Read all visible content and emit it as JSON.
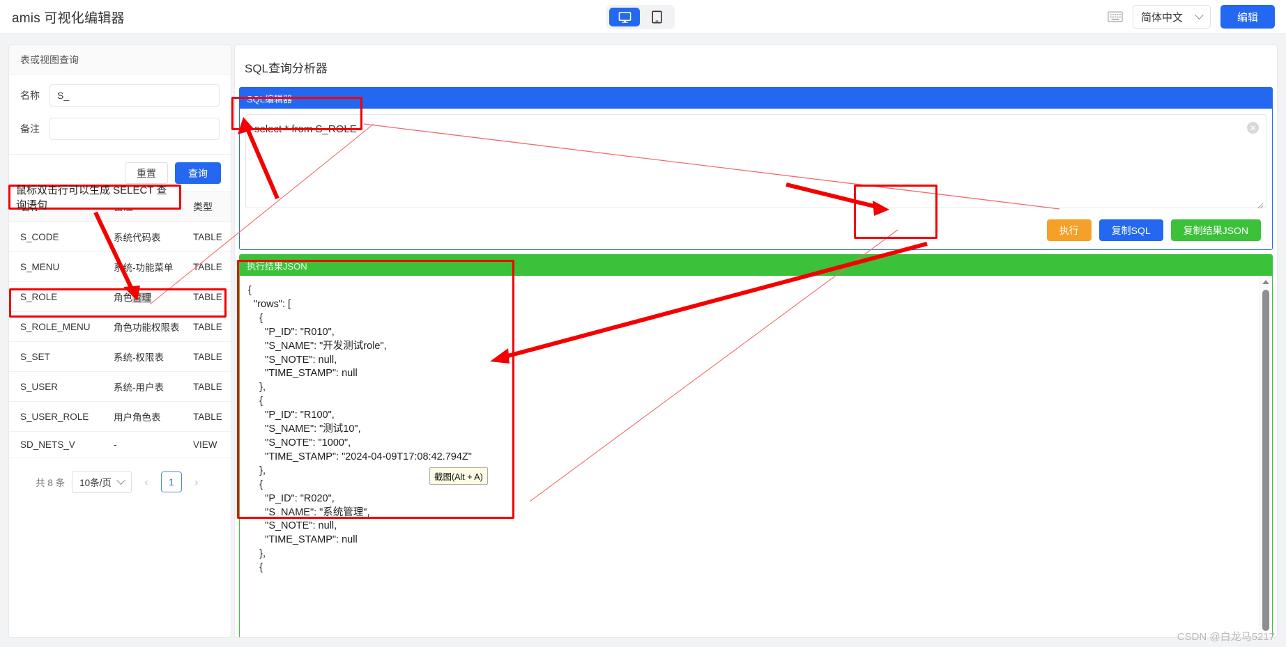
{
  "topbar": {
    "brand": "amis 可视化编辑器",
    "viewport": {
      "desktop_icon": "desktop-monitor-icon",
      "mobile_icon": "mobile-phone-icon",
      "active": "desktop"
    },
    "keyboard_icon": "keyboard-icon",
    "language": "简体中文",
    "language_chevron": "chevron-down-icon",
    "edit_button": "编辑"
  },
  "left_panel": {
    "header": "表或视图查询",
    "form": {
      "name_label": "名称",
      "name_value": "S_",
      "name_placeholder": "",
      "note_label": "备注",
      "note_value": "",
      "note_placeholder": "",
      "reset_button": "重置",
      "query_button": "查询"
    },
    "annotation_note": "鼠标双击行可以生成 SELECT 查询语句",
    "table": {
      "columns": [
        "名称",
        "备注",
        "类型"
      ],
      "rows": [
        {
          "name": "S_CODE",
          "note": "系统代码表",
          "type": "TABLE"
        },
        {
          "name": "S_MENU",
          "note": "系统-功能菜单",
          "type": "TABLE"
        },
        {
          "name": "S_ROLE",
          "note": "角色管理",
          "note_plain": "角色",
          "note_selected": "管理",
          "type": "TABLE"
        },
        {
          "name": "S_ROLE_MENU",
          "note": "角色功能权限表",
          "type": "TABLE"
        },
        {
          "name": "S_SET",
          "note": "系统-权限表",
          "type": "TABLE"
        },
        {
          "name": "S_USER",
          "note": "系统-用户表",
          "type": "TABLE"
        },
        {
          "name": "S_USER_ROLE",
          "note": "用户角色表",
          "type": "TABLE"
        },
        {
          "name": "SD_NETS_V",
          "note": "-",
          "type": "VIEW"
        }
      ]
    },
    "pagination": {
      "total_text": "共 8 条",
      "page_size": "10条/页",
      "page_size_chevron": "chevron-down-icon",
      "prev_icon": "chevron-left-icon",
      "next_icon": "chevron-right-icon",
      "current_page": "1"
    }
  },
  "right_panel": {
    "title": "SQL查询分析器",
    "sql_editor": {
      "header": "SQL编辑器",
      "value": "select * from S_ROLE",
      "placeholder": "",
      "clear_icon": "clear-circle-x-icon",
      "resize_icon": "resize-handle-icon",
      "buttons": {
        "execute": "执行",
        "copy_sql": "复制SQL",
        "copy_json": "复制结果JSON"
      }
    },
    "result": {
      "header": "执行结果JSON",
      "scroll_up_icon": "scroll-up-arrow-icon",
      "json_text": "{\n  \"rows\": [\n    {\n      \"P_ID\": \"R010\",\n      \"S_NAME\": \"开发测试role\",\n      \"S_NOTE\": null,\n      \"TIME_STAMP\": null\n    },\n    {\n      \"P_ID\": \"R100\",\n      \"S_NAME\": \"测试10\",\n      \"S_NOTE\": \"1000\",\n      \"TIME_STAMP\": \"2024-04-09T17:08:42.794Z\"\n    },\n    {\n      \"P_ID\": \"R020\",\n      \"S_NAME\": \"系统管理\",\n      \"S_NOTE\": null,\n      \"TIME_STAMP\": null\n    },\n    {"
    }
  },
  "overlay": {
    "tooltip": "截图(Alt + A)",
    "watermark": "CSDN @白龙马5217",
    "annotation_color": "#f40000"
  }
}
